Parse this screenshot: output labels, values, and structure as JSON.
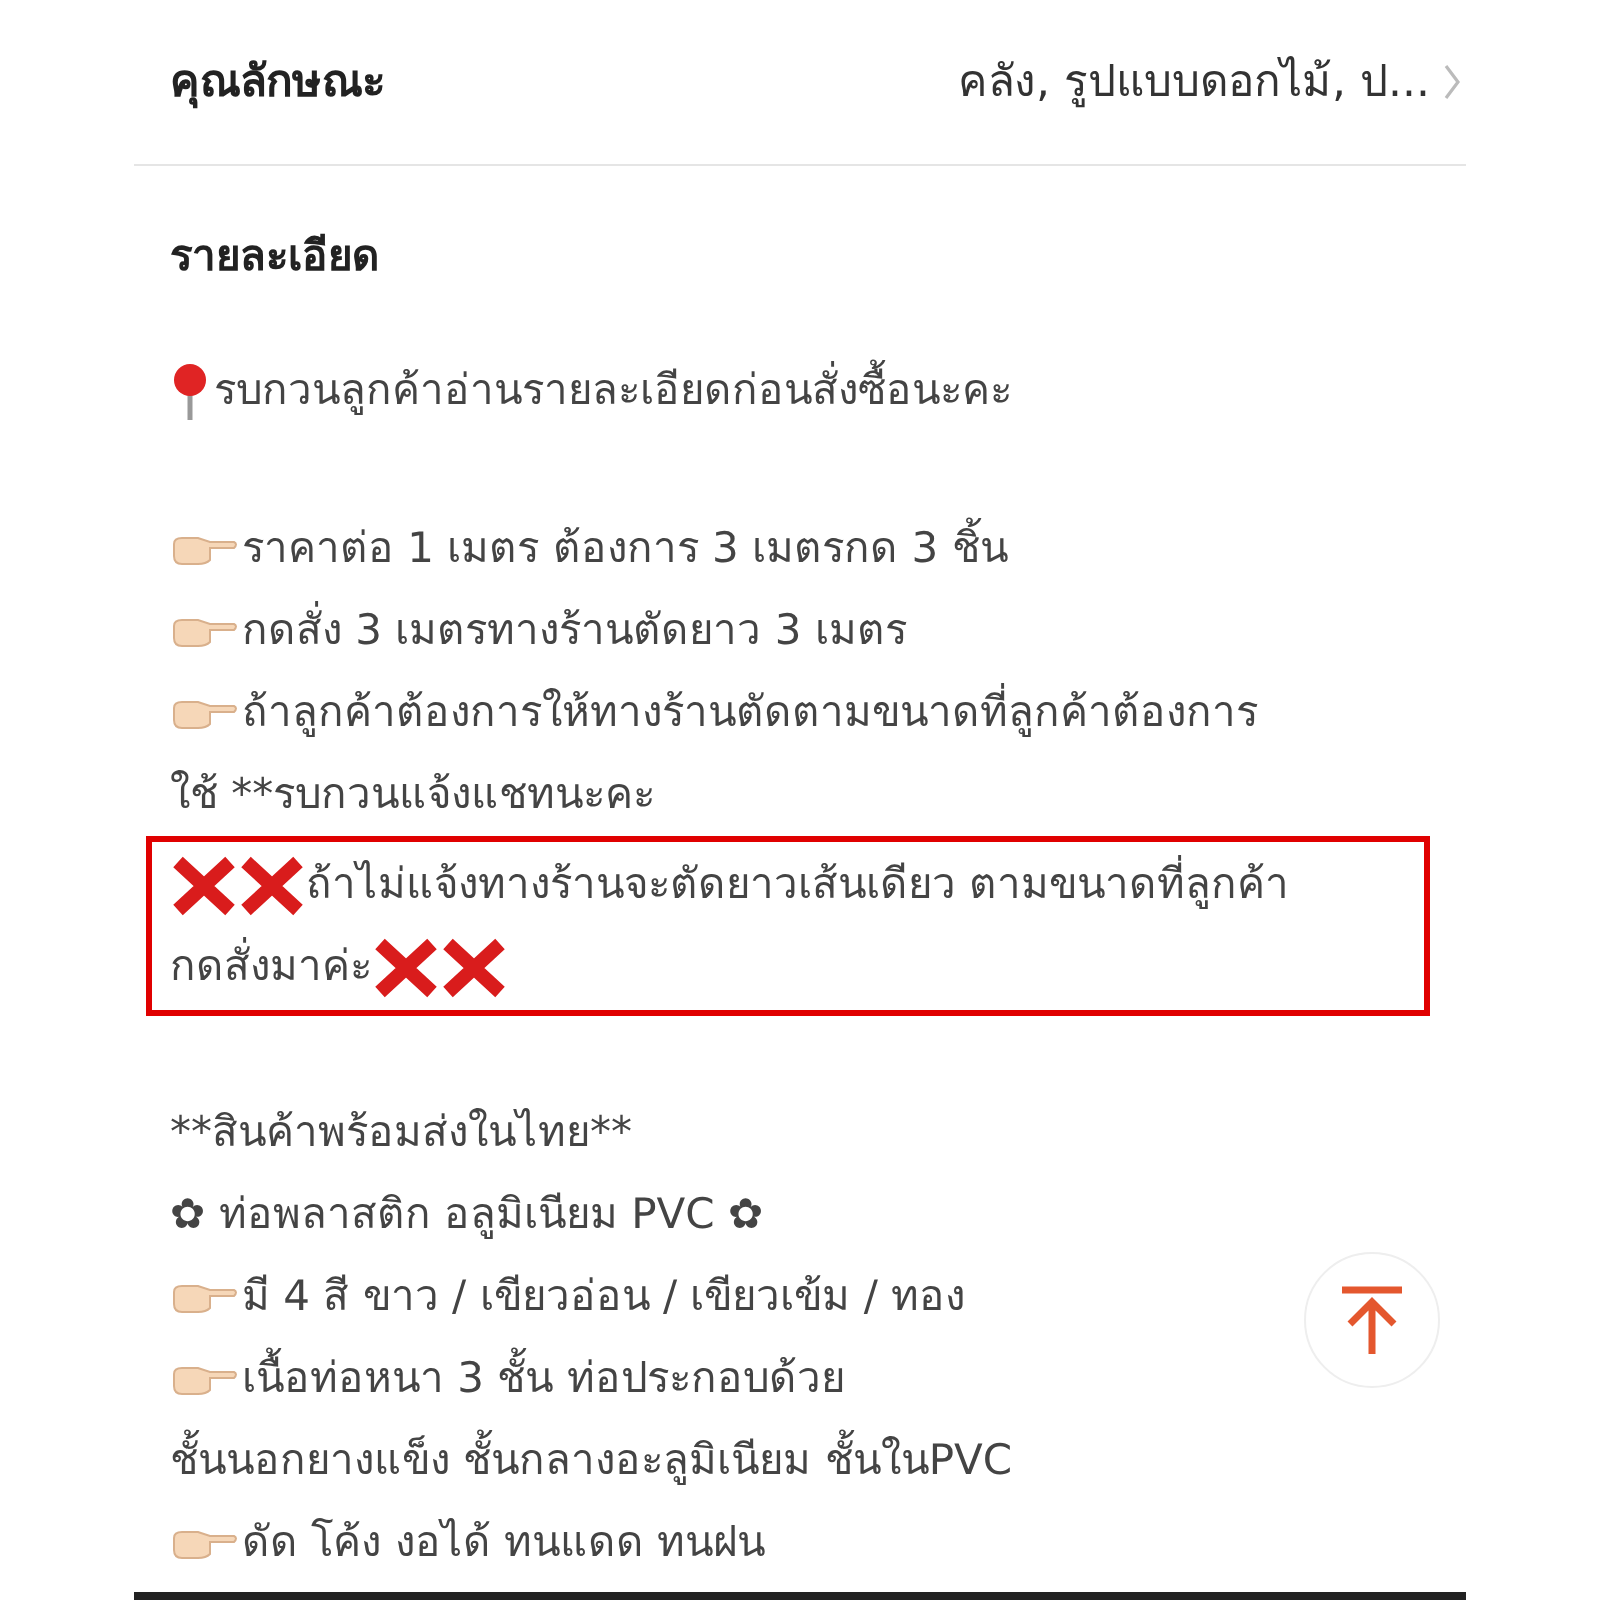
{
  "attribute": {
    "label": "คุณลักษณะ",
    "value": "คลัง, รูปแบบดอกไม้, ป..."
  },
  "details": {
    "title": "รายละเอียด",
    "blocks": [
      {
        "kind": "pinned",
        "text": "รบกวนลูกค้าอ่านรายละเอียดก่อนสั่งซื้อนะคะ"
      },
      {
        "kind": "gap"
      },
      {
        "kind": "pointed",
        "text": "ราคาต่อ 1 เมตร ต้องการ 3 เมตรกด 3 ชิ้น"
      },
      {
        "kind": "pointed",
        "text": "กดสั่ง 3 เมตรทางร้านตัดยาว 3 เมตร"
      },
      {
        "kind": "pointed",
        "text": "ถ้าลูกค้าต้องการให้ทางร้านตัดตามขนาดที่ลูกค้าต้องการ"
      },
      {
        "kind": "plain",
        "text": "ใช้ **รบกวนแจ้งแชทนะคะ"
      },
      {
        "kind": "notice",
        "lines": [
          {
            "kind": "lead",
            "text": "ถ้าไม่แจ้งทางร้านจะตัดยาวเส้นเดียว ตามขนาดที่ลูกค้า"
          },
          {
            "kind": "tail",
            "text": "กดสั่งมาค่ะ"
          }
        ]
      },
      {
        "kind": "gap"
      },
      {
        "kind": "plain",
        "text": "**สินค้าพร้อมส่งในไทย**"
      },
      {
        "kind": "plain",
        "text": "✿ ท่อพลาสติก อลูมิเนียม PVC ✿"
      },
      {
        "kind": "pointed",
        "text": "มี 4 สี ขาว / เขียวอ่อน / เขียวเข้ม / ทอง"
      },
      {
        "kind": "pointed",
        "text": "เนื้อท่อหนา 3 ชั้น ท่อประกอบด้วย"
      },
      {
        "kind": "plain",
        "text": "ชั้นนอกยางแข็ง ชั้นกลางอะลูมิเนียม ชั้นในPVC"
      },
      {
        "kind": "pointed",
        "text": "ดัด โค้ง งอได้ ทนแดด ทนฝน"
      }
    ]
  }
}
